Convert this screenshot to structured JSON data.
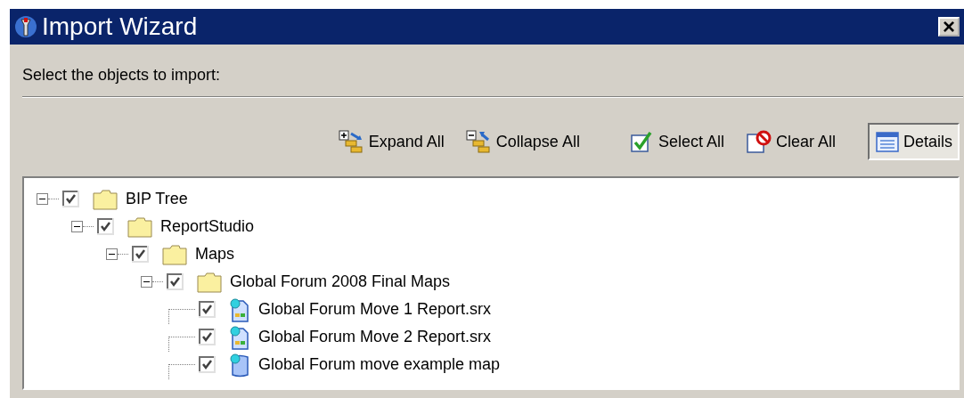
{
  "window": {
    "title": "Import Wizard",
    "close": "×"
  },
  "instruction": "Select the objects to import:",
  "toolbar": [
    {
      "kind": "expand",
      "label": "Expand All",
      "selected": false
    },
    {
      "kind": "collapse",
      "label": "Collapse All",
      "selected": false
    },
    {
      "kind": "select",
      "label": "Select All",
      "selected": false
    },
    {
      "kind": "clear",
      "label": "Clear All",
      "selected": false
    },
    {
      "kind": "details",
      "label": "Details",
      "selected": true
    }
  ],
  "tree": [
    {
      "kind": "folder",
      "label": "BIP Tree",
      "checked": true,
      "expanded": true,
      "children": [
        {
          "kind": "folder",
          "label": "ReportStudio",
          "checked": true,
          "expanded": true,
          "children": [
            {
              "kind": "folder",
              "label": "Maps",
              "checked": true,
              "expanded": true,
              "children": [
                {
                  "kind": "folder",
                  "label": "Global Forum 2008 Final Maps",
                  "checked": true,
                  "expanded": true,
                  "children": [
                    {
                      "kind": "report",
                      "label": "Global Forum Move 1 Report.srx",
                      "checked": true
                    },
                    {
                      "kind": "report",
                      "label": "Global Forum Move 2 Report.srx",
                      "checked": true
                    },
                    {
                      "kind": "map",
                      "label": "Global Forum move example map",
                      "checked": true
                    }
                  ]
                }
              ]
            }
          ]
        }
      ]
    }
  ]
}
